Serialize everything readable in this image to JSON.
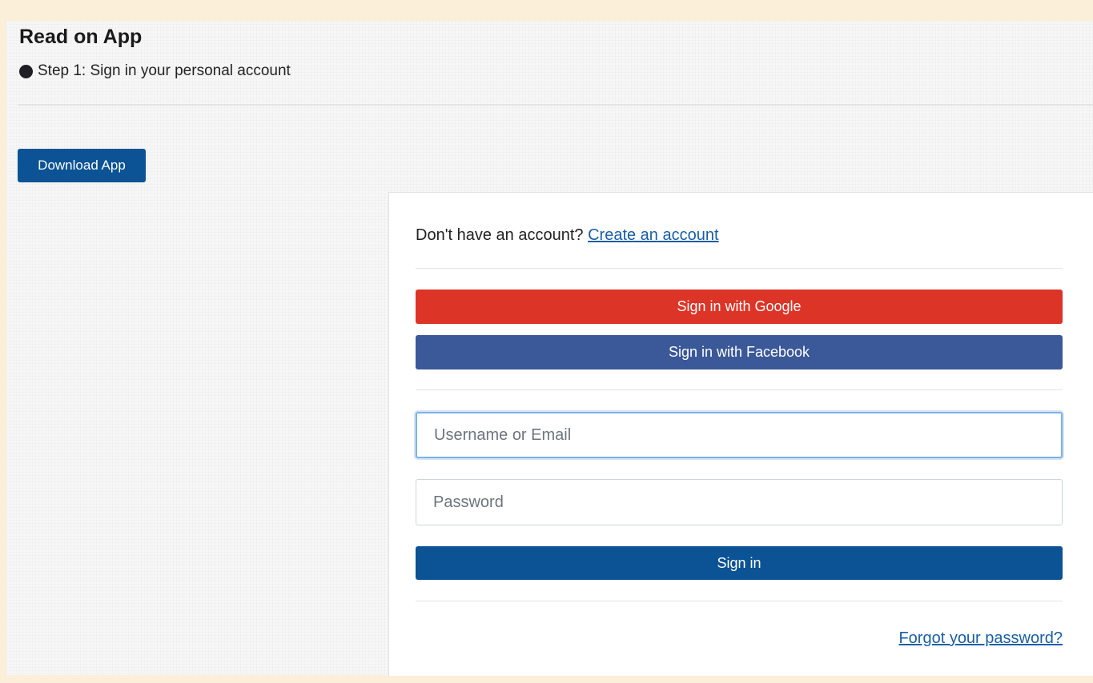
{
  "header": {
    "title": "Read on App",
    "step_text": "Step 1: Sign in your personal account"
  },
  "download_button_label": "Download App",
  "login": {
    "no_account_text": "Don't have an account?",
    "create_account_link": "Create an account",
    "google_button_label": "Sign in with Google",
    "facebook_button_label": "Sign in with Facebook",
    "username_placeholder": "Username or Email",
    "password_placeholder": "Password",
    "signin_button_label": "Sign in",
    "forgot_password_link": "Forgot your password?"
  },
  "colors": {
    "page_background": "#fbefd9",
    "primary_blue": "#0b5394",
    "google_red": "#dc3427",
    "facebook_blue": "#3b5998",
    "link_blue": "#1a5ea6"
  }
}
